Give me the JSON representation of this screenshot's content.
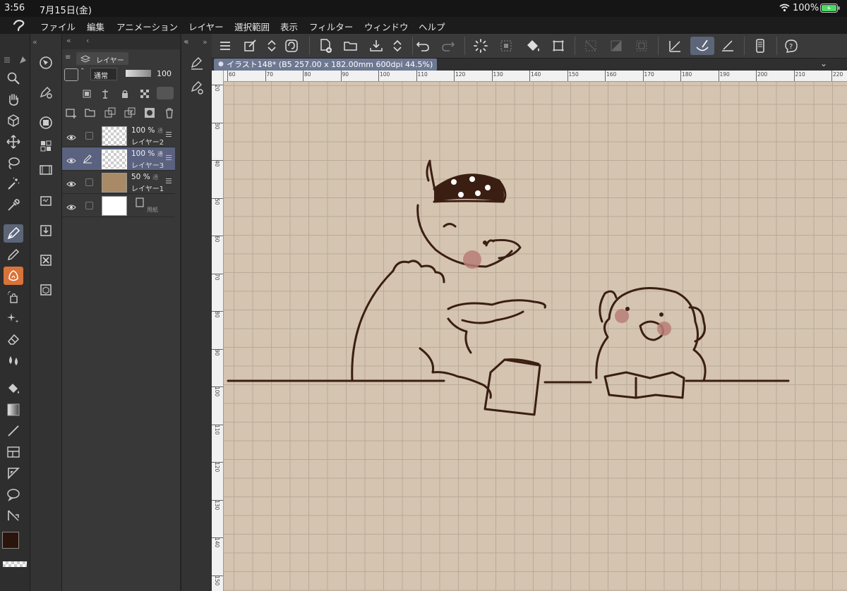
{
  "status": {
    "time": "3:56",
    "date": "7月15日(金)",
    "battery": "100%"
  },
  "menu": [
    "ファイル",
    "編集",
    "アニメーション",
    "レイヤー",
    "選択範囲",
    "表示",
    "フィルター",
    "ウィンドウ",
    "ヘルプ"
  ],
  "layer_panel": {
    "tab_label": "レイヤー",
    "blend_mode": "通常",
    "opacity_value": "100",
    "layers": [
      {
        "pct": "100 %",
        "mode": "通",
        "name": "レイヤー2",
        "thumb": "transparent",
        "selected": false
      },
      {
        "pct": "100 %",
        "mode": "通",
        "name": "レイヤー3",
        "thumb": "transparent",
        "selected": true
      },
      {
        "pct": "50 %",
        "mode": "通",
        "name": "レイヤー1",
        "thumb": "#a98a66",
        "selected": false
      },
      {
        "pct": "",
        "mode": "",
        "name": "用紙",
        "thumb": "#ffffff",
        "selected": false
      }
    ]
  },
  "document": {
    "tab_title": "イラスト148* (B5 257.00 x 182.00mm 600dpi 44.5%)"
  },
  "rulers": {
    "horizontal": [
      "60",
      "70",
      "80",
      "90",
      "100",
      "110",
      "120",
      "130",
      "140",
      "150",
      "160",
      "170",
      "180",
      "190",
      "200",
      "210",
      "220"
    ],
    "vertical": [
      "20",
      "30",
      "40",
      "50",
      "60",
      "70",
      "80",
      "90",
      "100",
      "110",
      "120",
      "130",
      "140",
      "150"
    ]
  },
  "colors": {
    "main": "#2b140c",
    "sub": "#b8857a",
    "canvas_bg": "#d4c4b0",
    "line": "#3b1e12",
    "accent_selected": "#5c6678"
  }
}
